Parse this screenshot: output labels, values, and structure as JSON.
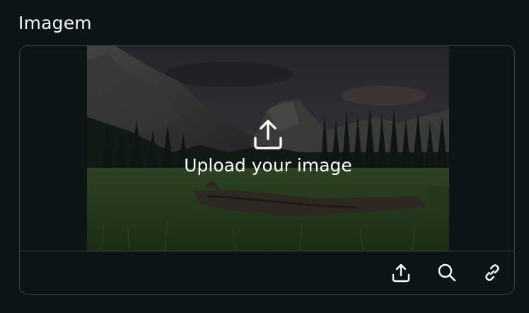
{
  "field": {
    "label": "Imagem"
  },
  "dropzone": {
    "cta_text": "Upload your image",
    "cta_icon": "upload-icon",
    "preview_subject": "mountain-meadow-landscape"
  },
  "toolbar": {
    "buttons": [
      {
        "icon": "upload-icon"
      },
      {
        "icon": "search-icon"
      },
      {
        "icon": "link-icon"
      }
    ]
  },
  "colors": {
    "background": "#0c1414",
    "border": "#3a4242",
    "text": "#ffffff"
  }
}
